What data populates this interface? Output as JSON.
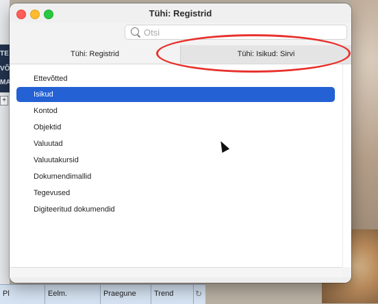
{
  "background": {
    "left_edge_text": [
      "TE",
      "VÕ",
      "MA"
    ],
    "left_plus": "+",
    "bottom_columns": [
      "Pl",
      "Eelm.",
      "Praegune",
      "Trend"
    ],
    "refresh_glyph": "↻"
  },
  "window": {
    "title": "Tühi: Registrid",
    "search_placeholder": "Otsi",
    "tabs": [
      {
        "label": "Tühi: Registrid",
        "selected": true
      },
      {
        "label": "Tühi: Isikud: Sirvi",
        "selected": false
      }
    ],
    "list_items": [
      {
        "label": "Ettevõtted",
        "selected": false
      },
      {
        "label": "Isikud",
        "selected": true
      },
      {
        "label": "Kontod",
        "selected": false
      },
      {
        "label": "Objektid",
        "selected": false
      },
      {
        "label": "Valuutad",
        "selected": false
      },
      {
        "label": "Valuutakursid",
        "selected": false
      },
      {
        "label": "Dokumendimallid",
        "selected": false
      },
      {
        "label": "Tegevused",
        "selected": false
      },
      {
        "label": "Digiteeritud dokumendid",
        "selected": false
      }
    ]
  },
  "colors": {
    "selection": "#2361d4",
    "annotation": "#e8312c"
  },
  "icons": {
    "close": "close-icon",
    "minimize": "minimize-icon",
    "zoom": "zoom-icon",
    "search": "search-icon",
    "cursor": "mouse-cursor-icon"
  }
}
